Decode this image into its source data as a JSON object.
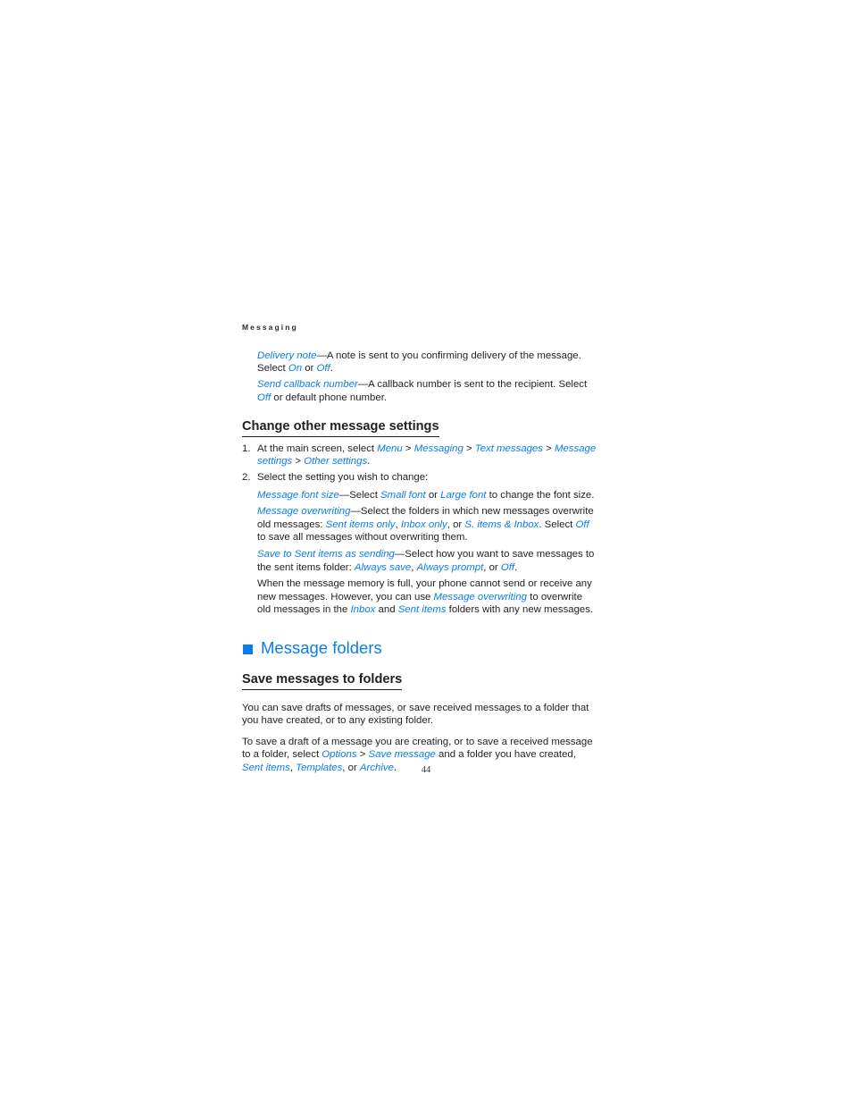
{
  "document": {
    "running_head": "Messaging",
    "page_number": "44",
    "accent_color": "#0a7cf0",
    "text_color": "#231f20"
  },
  "intro": {
    "para1": {
      "term": "Delivery note",
      "dash": "—",
      "text_a": "A note is sent to you confirming delivery of the message. Select ",
      "opt1": "On",
      "text_b": " or ",
      "opt2": "Off",
      "text_c": "."
    },
    "para2": {
      "term": "Send callback number",
      "dash": "—",
      "text_a": "A callback number is sent to the recipient. Select ",
      "opt1": "Off",
      "text_b": " or default phone number."
    }
  },
  "change_settings": {
    "heading": "Change other message settings",
    "steps": [
      {
        "num": "1.",
        "text_a": "At the main screen, select ",
        "path1": "Menu",
        "sep1": " > ",
        "path2": "Messaging",
        "sep2": " > ",
        "path3": "Text messages",
        "sep3": " > ",
        "path4": "Message settings",
        "sep4": " > ",
        "path5": "Other settings",
        "text_b": "."
      },
      {
        "num": "2.",
        "text_a": "Select the setting you wish to change:"
      }
    ],
    "font_size": {
      "term": "Message font size",
      "dash": "—",
      "text_a": "Select ",
      "opt1": "Small font",
      "text_b": " or ",
      "opt2": "Large font",
      "text_c": " to change the font size."
    },
    "overwriting": {
      "term": "Message overwriting",
      "dash": "—",
      "text_a": "Select the folders in which new messages overwrite old messages: ",
      "opt1": "Sent items only",
      "text_b": ", ",
      "opt2": "Inbox only",
      "text_c": ", or ",
      "opt3": "S. items & Inbox",
      "text_d": ". Select ",
      "opt4": "Off",
      "text_e": " to save all messages without overwriting them."
    },
    "save_to_sent": {
      "term": "Save to Sent items as sending",
      "dash": "—",
      "text_a": "Select how you want to save messages to the sent items folder: ",
      "opt1": "Always save",
      "text_b": ", ",
      "opt2": "Always prompt",
      "text_c": ", or ",
      "opt3": "Off",
      "text_d": "."
    },
    "memory_note": {
      "text_a": "When the message memory is full, your phone cannot send or receive any new messages. However, you can use ",
      "ref1": "Message overwriting",
      "text_b": " to overwrite old messages in the ",
      "ref2": "Inbox",
      "text_c": " and ",
      "ref3": "Sent items",
      "text_d": " folders with any new messages."
    }
  },
  "message_folders": {
    "title": "Message folders",
    "subhead": "Save messages to folders",
    "para1": "You can save drafts of messages, or save received messages to a folder that you have created, or to any existing folder.",
    "para2": {
      "text_a": "To save a draft of a message you are creating, or to save a received message to a folder, select ",
      "opt1": "Options",
      "sep1": " > ",
      "opt2": "Save message",
      "text_b": " and a folder you have created, ",
      "opt3": "Sent items",
      "text_c": ", ",
      "opt4": "Templates",
      "text_d": ", or ",
      "opt5": "Archive",
      "text_e": "."
    }
  }
}
